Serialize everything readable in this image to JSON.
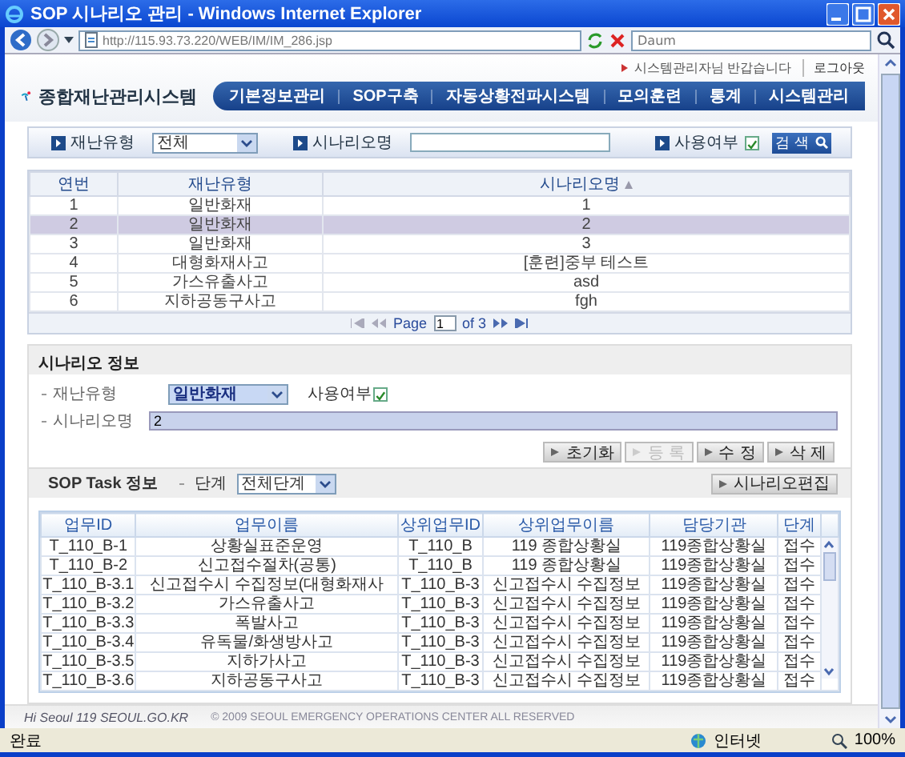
{
  "window": {
    "title": "SOP 시나리오 관리 - Windows Internet Explorer"
  },
  "browser": {
    "address": "http://115.93.73.220/WEB/IM/IM_286.jsp",
    "search_placeholder": "Daum"
  },
  "header": {
    "user_links": [
      {
        "text": "시스템관리자님 반갑습니다",
        "kind": "greeting"
      },
      {
        "text": "로그아웃",
        "kind": "link"
      }
    ],
    "logo": "종합재난관리시스템",
    "nav": [
      "기본정보관리",
      "SOP구축",
      "자동상황전파시스템",
      "모의훈련",
      "통계",
      "시스템관리"
    ]
  },
  "search": {
    "fields": [
      {
        "kind": "select",
        "label": "재난유형",
        "value": "전체"
      },
      {
        "kind": "text",
        "label": "시나리오명"
      },
      {
        "kind": "checkbox",
        "label": "사용여부",
        "checked": true
      }
    ],
    "button": "검 색"
  },
  "scenarios": {
    "columns": [
      "연번",
      "재난유형",
      "시나리오명"
    ],
    "rows": [
      {
        "cells": [
          "1",
          "일반화재",
          "1"
        ],
        "selected": false
      },
      {
        "cells": [
          "2",
          "일반화재",
          "2"
        ],
        "selected": true
      },
      {
        "cells": [
          "3",
          "일반화재",
          "3"
        ],
        "selected": false
      },
      {
        "cells": [
          "4",
          "대형화재사고",
          "[훈련]중부 테스트"
        ],
        "selected": false
      },
      {
        "cells": [
          "5",
          "가스유출사고",
          "asd"
        ],
        "selected": false
      },
      {
        "cells": [
          "6",
          "지하공동구사고",
          "fgh"
        ],
        "selected": false
      }
    ],
    "pager": {
      "label": "Page",
      "page": "1",
      "total": "of 3"
    }
  },
  "scenario_info": {
    "title": "시나리오 정보",
    "type_label": "재난유형",
    "type_value": "일반화재",
    "use_label": "사용여부",
    "use_checked": true,
    "name_label": "시나리오명",
    "name_value": "2",
    "buttons": [
      {
        "label": "초기화",
        "disabled": false
      },
      {
        "label": "등 록",
        "disabled": true
      },
      {
        "label": "수 정",
        "disabled": false
      },
      {
        "label": "삭 제",
        "disabled": false
      }
    ]
  },
  "sop_task": {
    "title": "SOP Task 정보",
    "stage_label": "단계",
    "stage_value": "전체단계",
    "edit_button": "시나리오편집",
    "columns": [
      "업무ID",
      "업무이름",
      "상위업무ID",
      "상위업무이름",
      "담당기관",
      "단계"
    ],
    "rows": [
      [
        "T_110_B-1",
        "상황실표준운영",
        "T_110_B",
        "119 종합상황실",
        "119종합상황실",
        "접수"
      ],
      [
        "T_110_B-2",
        "신고접수절차(공통)",
        "T_110_B",
        "119 종합상황실",
        "119종합상황실",
        "접수"
      ],
      [
        "T_110_B-3.1",
        "신고접수시 수집정보(대형화재사",
        "T_110_B-3",
        "신고접수시 수집정보",
        "119종합상황실",
        "접수"
      ],
      [
        "T_110_B-3.2",
        "가스유출사고",
        "T_110_B-3",
        "신고접수시 수집정보",
        "119종합상황실",
        "접수"
      ],
      [
        "T_110_B-3.3",
        "폭발사고",
        "T_110_B-3",
        "신고접수시 수집정보",
        "119종합상황실",
        "접수"
      ],
      [
        "T_110_B-3.4",
        "유독물/화생방사고",
        "T_110_B-3",
        "신고접수시 수집정보",
        "119종합상황실",
        "접수"
      ],
      [
        "T_110_B-3.5",
        "지하가사고",
        "T_110_B-3",
        "신고접수시 수집정보",
        "119종합상황실",
        "접수"
      ],
      [
        "T_110_B-3.6",
        "지하공동구사고",
        "T_110_B-3",
        "신고접수시 수집정보",
        "119종합상황실",
        "접수"
      ]
    ]
  },
  "footer": {
    "logo": "Hi Seoul 119 SEOUL.GO.KR",
    "copyright": "© 2009 SEOUL EMERGENCY OPERATIONS CENTER ALL RESERVED"
  },
  "status_bar": {
    "text": "완료",
    "zone": "인터넷",
    "zoom": "100%"
  }
}
